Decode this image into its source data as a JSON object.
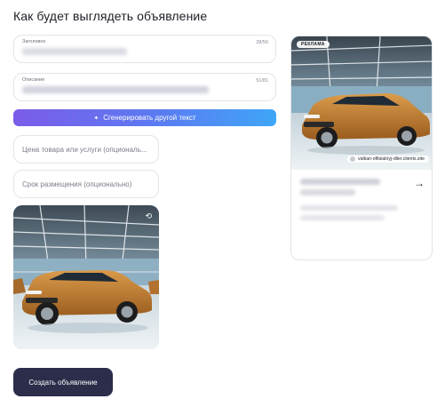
{
  "page": {
    "title": "Как будет выглядеть объявление"
  },
  "form": {
    "title_field": {
      "label": "Заголовок",
      "counter": "28/56"
    },
    "description_field": {
      "label": "Описание",
      "counter": "51/81"
    },
    "generate_button": {
      "label": "Сгенерировать другой текст",
      "icon": "sparkle-icon"
    },
    "price_input": {
      "placeholder": "Цена товара или услуги (опциональ..."
    },
    "term_input": {
      "placeholder": "Срок размещения (опционально)"
    },
    "image": {
      "icon": "reload-icon"
    }
  },
  "preview": {
    "badge": "РЕКЛАМА",
    "site": "valkan-ofitsialnyj-diler.clients.site",
    "arrow_icon": "arrow-right-icon"
  },
  "footer": {
    "create_button": "Создать объявление"
  }
}
